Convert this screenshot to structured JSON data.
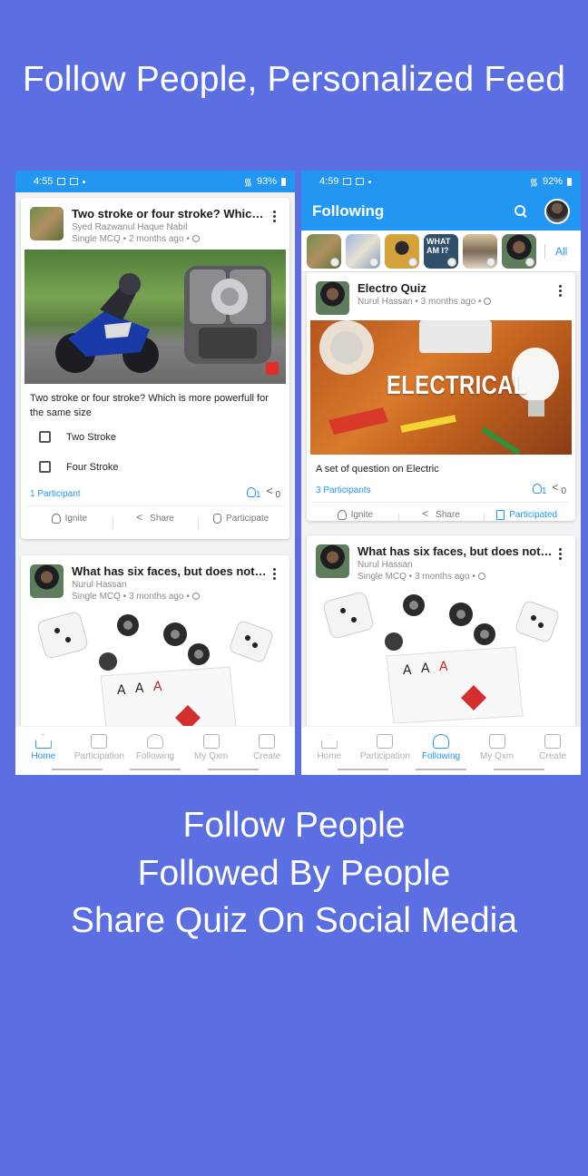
{
  "headline": "Follow People, Personalized Feed",
  "left_phone": {
    "status": {
      "time": "4:55",
      "battery": "93%"
    },
    "cards": [
      {
        "title": "Two stroke or four stroke? Which i...",
        "author": "Syed Razwanul Haque Nabil",
        "meta": "Single MCQ • 2 months ago •",
        "description": "Two stroke or four stroke? Which is more powerfull for the same size",
        "options": [
          "Two Stroke",
          "Four Stroke"
        ],
        "participants": "1 Participant",
        "ignite_count": "1",
        "share_count": "0",
        "actions": [
          "Ignite",
          "Share",
          "Participate"
        ]
      },
      {
        "title": "What has six faces, but does not w...",
        "author": "Nurul Hassan",
        "meta": "Single MCQ • 3 months ago •"
      }
    ],
    "nav": [
      "Home",
      "Participation",
      "Following",
      "My Qxm",
      "Create"
    ],
    "active_nav": "Home"
  },
  "right_phone": {
    "status": {
      "time": "4:59",
      "battery": "92%"
    },
    "appbar_title": "Following",
    "stories_all": "All",
    "story_label": "WHAT AM I?",
    "cards": [
      {
        "title": "Electro Quiz",
        "author": "Nurul Hassan",
        "meta": "• 3 months ago •",
        "image_text": "ELECTRICAL",
        "description": "A set of question on Electric",
        "participants": "3 Participants",
        "ignite_count": "1",
        "share_count": "0",
        "actions": [
          "Ignite",
          "Share",
          "Participated"
        ]
      },
      {
        "title": "What has six faces, but does not w...",
        "author": "Nurul Hassan",
        "meta": "Single MCQ • 3 months ago •"
      }
    ],
    "nav": [
      "Home",
      "Participation",
      "Following",
      "My Qxm",
      "Create"
    ],
    "active_nav": "Following"
  },
  "bottom_lines": [
    "Follow People",
    "Followed By People",
    "Share Quiz On Social Media"
  ],
  "colors": {
    "background": "#5b6fe3",
    "primary": "#2196f3"
  }
}
